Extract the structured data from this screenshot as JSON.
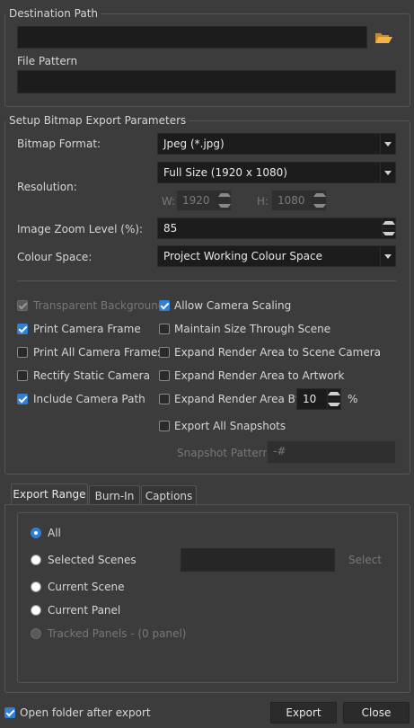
{
  "destination": {
    "legend": "Destination Path",
    "path_value": "",
    "file_pattern_label": "File Pattern",
    "file_pattern_value": ""
  },
  "setup": {
    "legend": "Setup Bitmap Export Parameters",
    "bitmap_format_label": "Bitmap Format:",
    "bitmap_format_value": "Jpeg (*.jpg)",
    "resolution_label": "Resolution:",
    "resolution_value": "Full Size (1920 x 1080)",
    "w_label": "W:",
    "w_value": "1920",
    "h_label": "H:",
    "h_value": "1080",
    "zoom_label": "Image Zoom Level (%):",
    "zoom_value": "85",
    "colour_space_label": "Colour Space:",
    "colour_space_value": "Project Working Colour Space"
  },
  "options_left": [
    {
      "label": "Transparent Background",
      "checked": true,
      "disabled": true
    },
    {
      "label": "Print Camera Frame",
      "checked": true,
      "disabled": false
    },
    {
      "label": "Print All Camera Frames",
      "checked": false,
      "disabled": false
    },
    {
      "label": "Rectify Static Camera",
      "checked": false,
      "disabled": false
    },
    {
      "label": "Include Camera Path",
      "checked": true,
      "disabled": false
    }
  ],
  "options_right": [
    {
      "label": "Allow Camera Scaling",
      "checked": true
    },
    {
      "label": "Maintain Size Through Scene",
      "checked": false
    },
    {
      "label": "Expand Render Area to Scene Camera",
      "checked": false
    },
    {
      "label": "Expand Render Area to Artwork",
      "checked": false
    },
    {
      "label": "Expand Render Area By:",
      "checked": false
    },
    {
      "label": "Export All Snapshots",
      "checked": false
    }
  ],
  "expand_by_value": "10",
  "expand_by_unit": "%",
  "snapshot_pattern_label": "Snapshot Pattern:",
  "snapshot_pattern_value": "-#",
  "tabs": [
    {
      "label": "Export Range",
      "active": true
    },
    {
      "label": "Burn-In",
      "active": false
    },
    {
      "label": "Captions",
      "active": false
    }
  ],
  "range": [
    {
      "label": "All",
      "selected": true,
      "disabled": false
    },
    {
      "label": "Selected Scenes",
      "selected": false,
      "disabled": false
    },
    {
      "label": "Current Scene",
      "selected": false,
      "disabled": false
    },
    {
      "label": "Current Panel",
      "selected": false,
      "disabled": false
    },
    {
      "label": "Tracked Panels - (0 panel)",
      "selected": false,
      "disabled": true
    }
  ],
  "select_button_label": "Select",
  "footer": {
    "open_folder_label": "Open folder after export",
    "open_folder_checked": true,
    "export_label": "Export",
    "close_label": "Close"
  },
  "colors": {
    "background": "#3c3c3c",
    "field": "#1c1c1c",
    "accent": "#2f7fd8",
    "folder_icon": "#e8a73a"
  },
  "icons": {
    "browse": "folder-open-icon"
  }
}
